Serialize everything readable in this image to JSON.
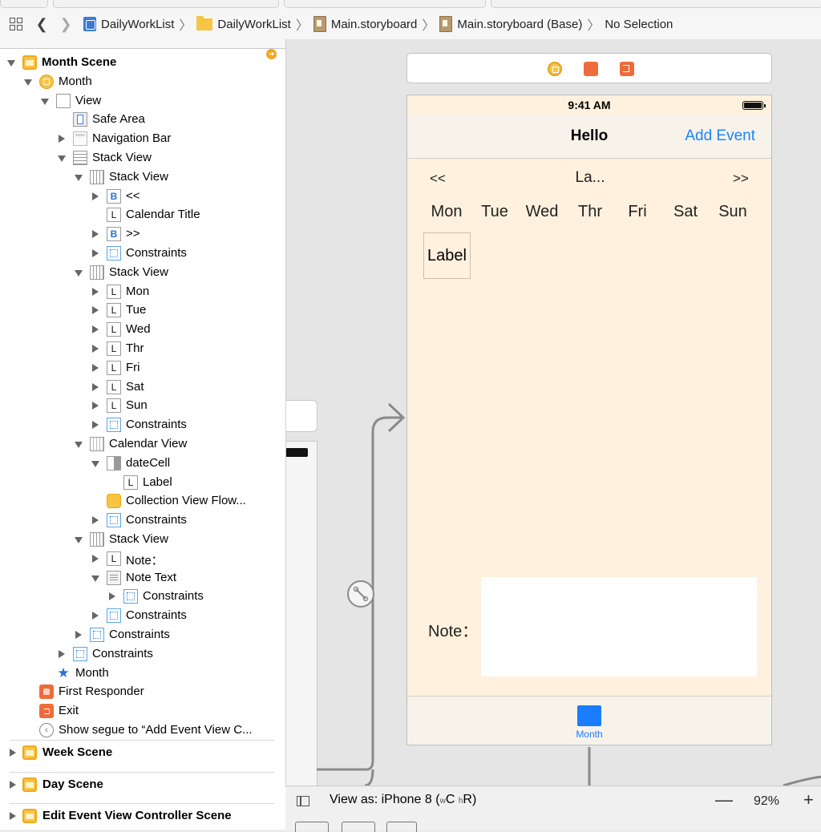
{
  "jumpbar": {
    "crumbs": [
      "DailyWorkList",
      "DailyWorkList",
      "Main.storyboard",
      "Main.storyboard (Base)",
      "No Selection"
    ]
  },
  "outline": {
    "month_scene": "Month Scene",
    "rows": [
      "Month",
      "View",
      "Safe Area",
      "Navigation Bar",
      "Stack View",
      "Stack View",
      "<<",
      "Calendar Title",
      ">>",
      "Constraints",
      "Stack View",
      "Mon",
      "Tue",
      "Wed",
      "Thr",
      "Fri",
      "Sat",
      "Sun",
      "Constraints",
      "Calendar View",
      "dateCell",
      "Label",
      "Collection View Flow...",
      "Constraints",
      "Stack View",
      "Note：",
      "Note Text",
      "Constraints",
      "Constraints",
      "Constraints",
      "Constraints",
      "Month",
      "First Responder",
      "Exit",
      "Show segue to “Add Event View C..."
    ],
    "icon_letters": {
      "button": "B",
      "label": "L"
    },
    "scenes": [
      "Week Scene",
      "Day Scene",
      "Edit Event View Controller Scene"
    ]
  },
  "canvas": {
    "status_time": "9:41 AM",
    "nav_title": "Hello",
    "nav_right": "Add Event",
    "prev": "<<",
    "calendar_title": "La...",
    "next": ">>",
    "weekdays": [
      "Mon",
      "Tue",
      "Wed",
      "Thr",
      "Fri",
      "Sat",
      "Sun"
    ],
    "cell_label": "Label",
    "note_label": "Note：",
    "tab_label": "Month",
    "accent_color": "#1a7cff"
  },
  "bottombar": {
    "view_as": "View as: iPhone 8",
    "size_class_w": "w",
    "size_class_c": "C",
    "size_class_h": "h",
    "size_class_r": "R",
    "zoom_out": "—",
    "zoom": "92%",
    "zoom_in": "+"
  }
}
